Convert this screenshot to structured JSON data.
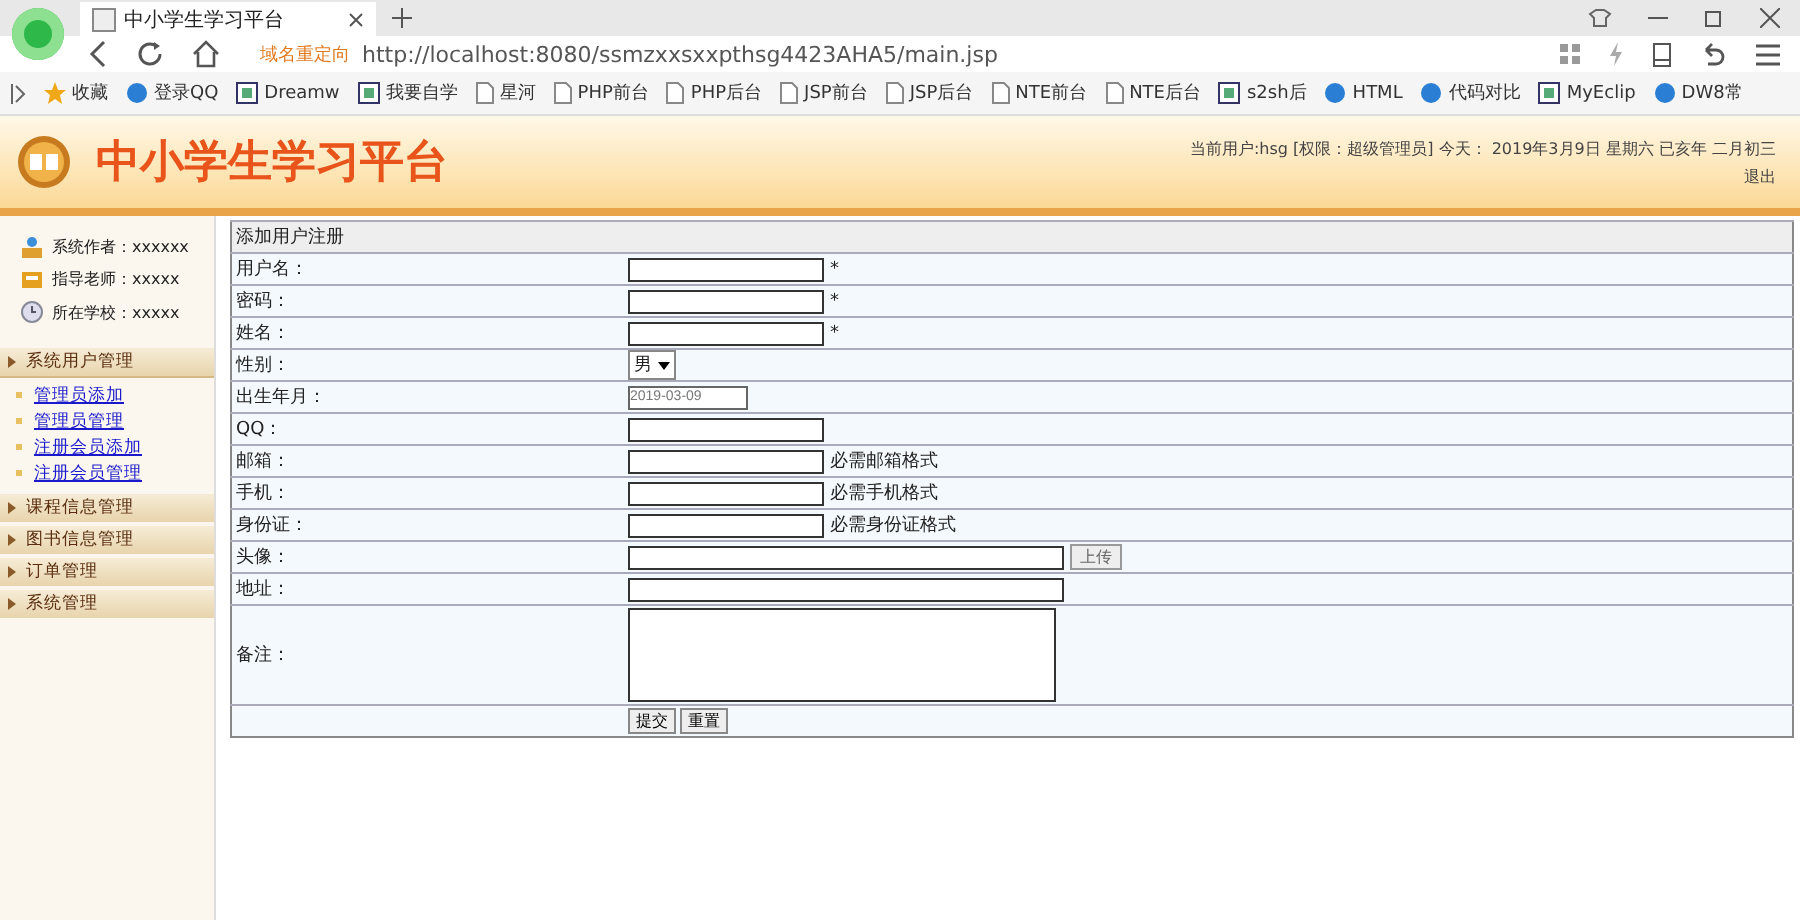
{
  "browser": {
    "tab_title": "中小学生学习平台",
    "redirect_label": "域名重定向",
    "url": "http://localhost:8080/ssmzxxsxxpthsg4423AHA5/main.jsp",
    "bookmarks": [
      {
        "label": "收藏",
        "kind": "star"
      },
      {
        "label": "登录QQ",
        "kind": "round"
      },
      {
        "label": "Dreamw",
        "kind": "square"
      },
      {
        "label": "我要自学",
        "kind": "square"
      },
      {
        "label": "星河",
        "kind": "page"
      },
      {
        "label": "PHP前台",
        "kind": "page"
      },
      {
        "label": "PHP后台",
        "kind": "page"
      },
      {
        "label": "JSP前台",
        "kind": "page"
      },
      {
        "label": "JSP后台",
        "kind": "page"
      },
      {
        "label": "NTE前台",
        "kind": "page"
      },
      {
        "label": "NTE后台",
        "kind": "page"
      },
      {
        "label": "s2sh后",
        "kind": "square"
      },
      {
        "label": "HTML",
        "kind": "round"
      },
      {
        "label": "代码对比",
        "kind": "round"
      },
      {
        "label": "MyEclip",
        "kind": "square"
      },
      {
        "label": "DW8常",
        "kind": "round"
      }
    ]
  },
  "header": {
    "title": "中小学生学习平台",
    "user_info": "当前用户:hsg [权限：超级管理员] 今天： 2019年3月9日 星期六 已亥年 二月初三",
    "logout": "退出"
  },
  "sidebar": {
    "info": [
      {
        "text": "系统作者：xxxxxx"
      },
      {
        "text": "指导老师：xxxxx"
      },
      {
        "text": "所在学校：xxxxx"
      }
    ],
    "sections": [
      {
        "label": "系统用户管理",
        "expanded": true,
        "items": [
          {
            "label": "管理员添加"
          },
          {
            "label": "管理员管理"
          },
          {
            "label": "注册会员添加"
          },
          {
            "label": "注册会员管理"
          }
        ]
      },
      {
        "label": "课程信息管理",
        "expanded": false
      },
      {
        "label": "图书信息管理",
        "expanded": false
      },
      {
        "label": "订单管理",
        "expanded": false
      },
      {
        "label": "系统管理",
        "expanded": false
      }
    ]
  },
  "form": {
    "title": "添加用户注册",
    "rows": [
      {
        "label": "用户名：",
        "kind": "text",
        "note": "*"
      },
      {
        "label": "密码：",
        "kind": "text",
        "note": "*"
      },
      {
        "label": "姓名：",
        "kind": "text",
        "note": "*"
      },
      {
        "label": "性别：",
        "kind": "select",
        "value": "男"
      },
      {
        "label": "出生年月：",
        "kind": "date",
        "value": "2019-03-09"
      },
      {
        "label": "QQ：",
        "kind": "text"
      },
      {
        "label": "邮箱：",
        "kind": "text",
        "note": "必需邮箱格式"
      },
      {
        "label": "手机：",
        "kind": "text",
        "note": "必需手机格式"
      },
      {
        "label": "身份证：",
        "kind": "text",
        "note": "必需身份证格式"
      },
      {
        "label": "头像：",
        "kind": "upload",
        "button": "上传"
      },
      {
        "label": "地址：",
        "kind": "wide"
      },
      {
        "label": "备注：",
        "kind": "textarea"
      }
    ],
    "buttons": [
      "提交",
      "重置"
    ]
  }
}
